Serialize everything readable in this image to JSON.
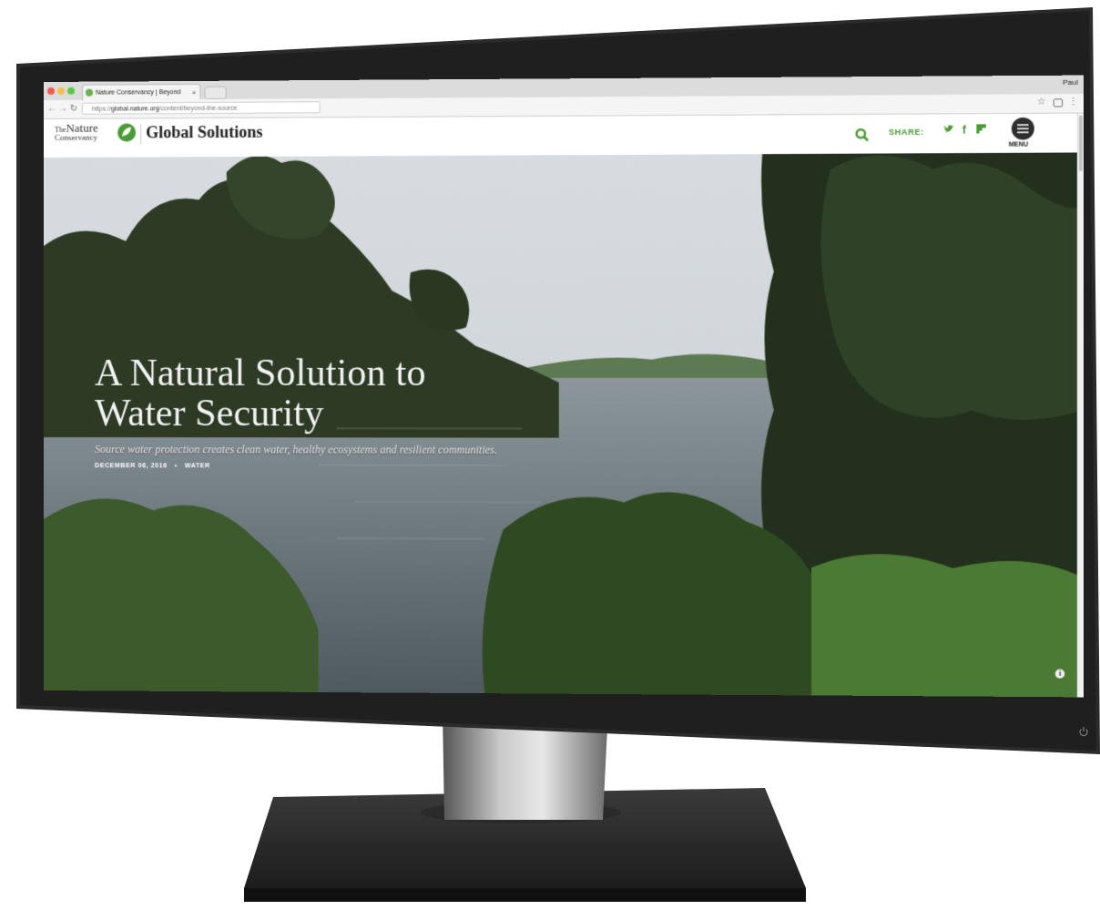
{
  "browser": {
    "tab_title": "Nature Conservancy | Beyond",
    "tab_close": "×",
    "profile_name": "Paul",
    "url_scheme": "https://",
    "url_host": "global.nature.org",
    "url_path": "/content/beyond-the-source"
  },
  "site": {
    "logo_the": "The",
    "logo_nature": "Nature",
    "logo_conservancy": "Conservancy",
    "title": "Global Solutions",
    "share_label": "SHARE:",
    "social_twitter": "✓",
    "social_facebook": "f",
    "social_flag": "⚑",
    "menu_label": "MENU",
    "accent_color": "#4a9a35"
  },
  "hero": {
    "headline_line1": "A Natural Solution to",
    "headline_line2": "Water Security",
    "subheadline": "Source water protection creates clean water, healthy ecosystems and resilient communities.",
    "date": "DECEMBER 06, 2016",
    "separator": "•",
    "category": "WATER",
    "info_glyph": "i"
  },
  "icons": {
    "search": "search-icon",
    "menu": "hamburger-menu-icon",
    "power": "power-icon",
    "info": "info-icon",
    "star": "star-icon",
    "kebab": "kebab-menu-icon"
  }
}
